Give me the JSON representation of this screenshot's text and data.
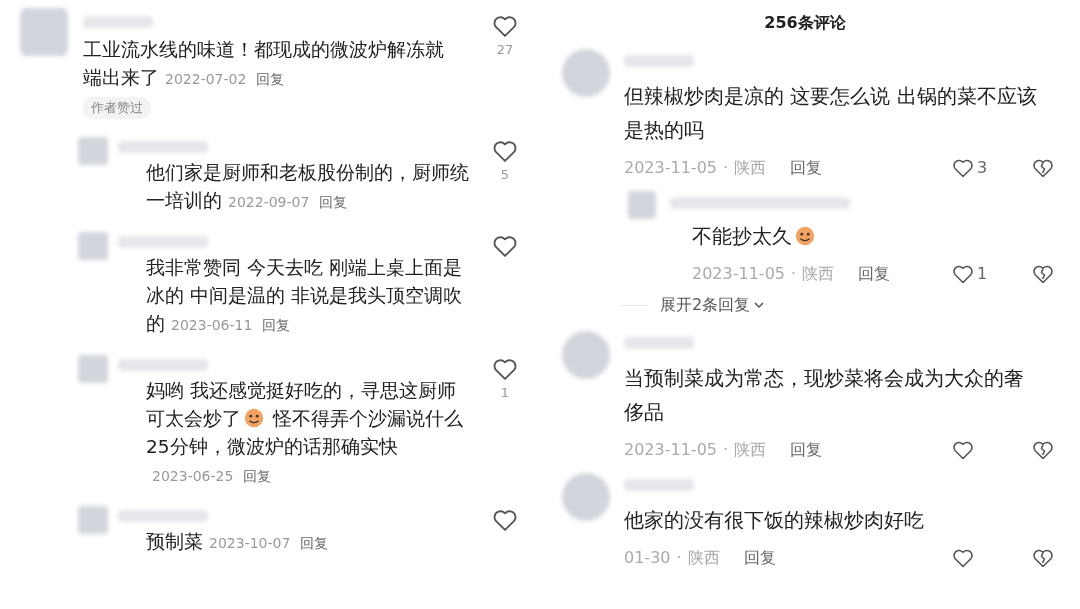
{
  "left_thread": {
    "comment": {
      "parts": [
        {
          "kind": "text",
          "text": "工业流水线的味道！都现成的微波炉解冻就端出来了"
        }
      ],
      "date": "2022-07-02",
      "reply_label": "回复",
      "likes": "27",
      "badge": "作者赞过"
    },
    "replies": [
      {
        "parts": [
          {
            "kind": "text",
            "text": "他们家是厨师和老板股份制的，厨师统一培训的"
          }
        ],
        "date": "2022-09-07",
        "reply_label": "回复",
        "likes": "5"
      },
      {
        "parts": [
          {
            "kind": "text",
            "text": "我非常赞同  今天去吃 刚端上桌上面是冰的  中间是温的  非说是我头顶空调吹的"
          }
        ],
        "date": "2023-06-11",
        "reply_label": "回复"
      },
      {
        "parts": [
          {
            "kind": "text",
            "text": "妈哟  我还感觉挺好吃的，寻思这厨师可太会炒了"
          },
          {
            "kind": "emoji"
          },
          {
            "kind": "text",
            "text": "  怪不得弄个沙漏说什么25分钟，微波炉的话那确实快"
          }
        ],
        "date": "2023-06-25",
        "reply_label": "回复",
        "likes": "1"
      },
      {
        "parts": [
          {
            "kind": "text",
            "text": "预制菜"
          }
        ],
        "date": "2023-10-07",
        "reply_label": "回复"
      }
    ]
  },
  "right_panel": {
    "title": "256条评论",
    "comments": [
      {
        "parts": [
          {
            "kind": "text",
            "text": "但辣椒炒肉是凉的 这要怎么说 出锅的菜不应该是热的吗"
          }
        ],
        "date": "2023-11-05",
        "separator": "·",
        "location": "陕西",
        "reply_label": "回复",
        "likes": "3",
        "replies": [
          {
            "parts": [
              {
                "kind": "text",
                "text": "不能抄太久"
              },
              {
                "kind": "emoji"
              }
            ],
            "date": "2023-11-05",
            "separator": "·",
            "location": "陕西",
            "reply_label": "回复",
            "likes": "1"
          }
        ],
        "expand_label": "展开2条回复"
      },
      {
        "parts": [
          {
            "kind": "text",
            "text": "当预制菜成为常态，现炒菜将会成为大众的奢侈品"
          }
        ],
        "date": "2023-11-05",
        "separator": "·",
        "location": "陕西",
        "reply_label": "回复"
      },
      {
        "parts": [
          {
            "kind": "text",
            "text": "他家的没有很下饭的辣椒炒肉好吃"
          }
        ],
        "date": "01-30",
        "separator": "·",
        "location": "陕西",
        "reply_label": "回复"
      }
    ]
  }
}
